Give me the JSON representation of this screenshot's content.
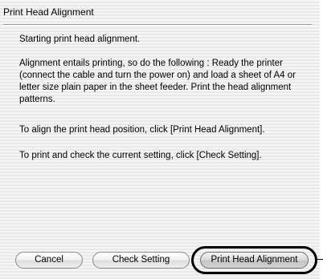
{
  "dialog": {
    "title": "Print Head Alignment",
    "messages": [
      "Starting print head alignment.",
      "Alignment entails printing, so do the following : Ready the printer (connect the cable and turn the power on) and load a sheet of A4 or letter size plain paper in the sheet feeder. Print the head alignment patterns.",
      "To align the print head position, click [Print Head Alignment].",
      "To print and check the current setting, click [Check Setting]."
    ],
    "buttons": {
      "cancel": "Cancel",
      "check_setting": "Check Setting",
      "print_head_alignment": "Print Head Alignment"
    }
  },
  "annotation": {
    "highlighted_button": "print_head_alignment"
  }
}
